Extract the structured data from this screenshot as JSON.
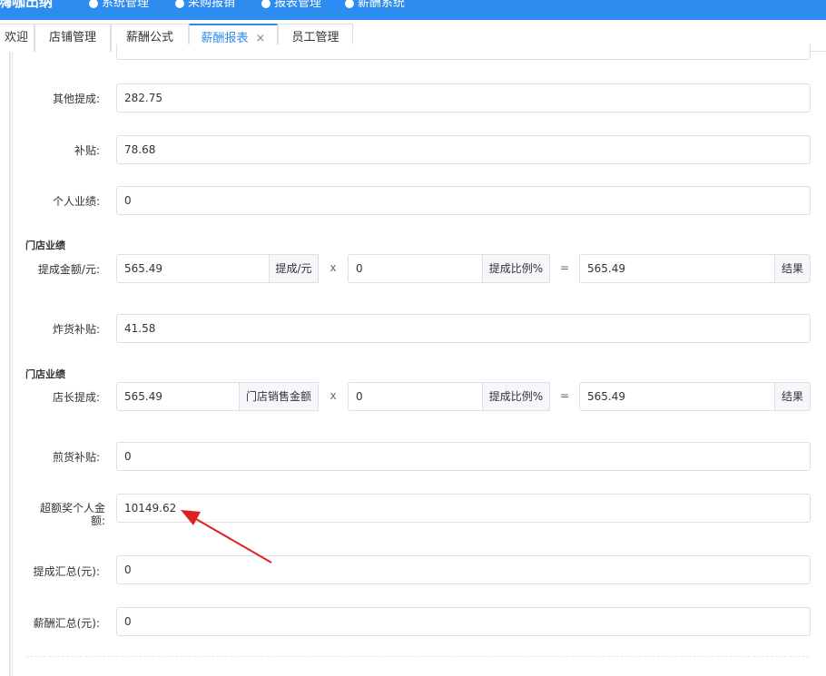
{
  "topbar": {
    "brand": "嗨咖出纳",
    "nav": [
      "系统管理",
      "采购报销",
      "报表管理",
      "薪酬系统"
    ]
  },
  "tabs": [
    "欢迎",
    "店铺管理",
    "薪酬公式",
    "薪酬报表",
    "员工管理"
  ],
  "tab_close": "×",
  "form": {
    "other_commission_label": "其他提成:",
    "other_commission_value": "282.75",
    "subsidy_label": "补贴:",
    "subsidy_value": "78.68",
    "personal_perf_label": "个人业绩:",
    "personal_perf_value": "0",
    "section1": "门店业绩",
    "amount_label": "提成金额/元:",
    "amount_value": "565.49",
    "amount_addon": "提成/元",
    "times": "x",
    "ratio_value": "0",
    "ratio_addon": "提成比例%",
    "equals": "=",
    "result_value": "565.49",
    "result_addon": "结果",
    "fried_subsidy_label": "炸货补贴:",
    "fried_subsidy_value": "41.58",
    "section2": "门店业绩",
    "manager_label": "店长提成:",
    "manager_value": "565.49",
    "manager_addon": "门店销售金额",
    "ratio2_value": "0",
    "ratio2_addon": "提成比例%",
    "result2_value": "565.49",
    "result2_addon": "结果",
    "pan_subsidy_label": "煎货补贴:",
    "pan_subsidy_value": "0",
    "excess_bonus_label": "超额奖个人金额:",
    "excess_bonus_value": "10149.62",
    "commission_total_label": "提成汇总(元):",
    "commission_total_value": "0",
    "salary_total_label": "薪酬汇总(元):",
    "salary_total_value": "0"
  },
  "colors": {
    "primary": "#2d8cf0",
    "arrow": "#e02020"
  }
}
